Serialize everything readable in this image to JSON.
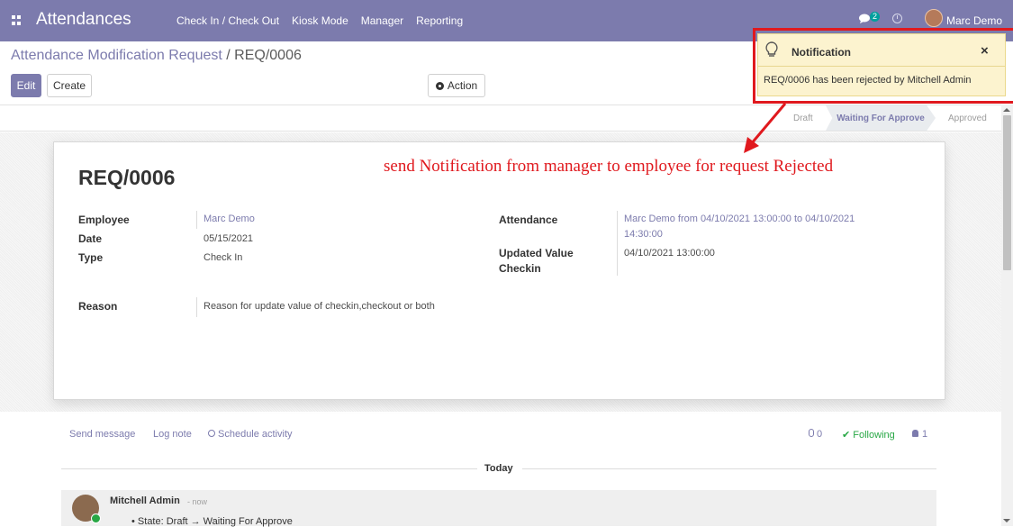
{
  "navbar": {
    "app_name": "Attendances",
    "menu": [
      "Check In / Check Out",
      "Kiosk Mode",
      "Manager",
      "Reporting"
    ],
    "chat_count": "2",
    "user_name": "Marc Demo"
  },
  "control": {
    "breadcrumb_parent": "Attendance Modification Request",
    "breadcrumb_sep": " / ",
    "breadcrumb_current": "REQ/0006",
    "edit_label": "Edit",
    "create_label": "Create",
    "action_label": "Action"
  },
  "statusbar": {
    "stages": [
      "Draft",
      "Waiting For Approve",
      "Approved"
    ],
    "active": "Waiting For Approve"
  },
  "form": {
    "title": "REQ/0006",
    "employee_label": "Employee",
    "employee_value": "Marc Demo",
    "date_label": "Date",
    "date_value": "05/15/2021",
    "type_label": "Type",
    "type_value": "Check In",
    "attendance_label": "Attendance",
    "attendance_value_line1": "Marc Demo from 04/10/2021 13:00:00 to 04/10/2021",
    "attendance_value_line2": "14:30:00",
    "updated_label_line1": "Updated Value",
    "updated_label_line2": "Checkin",
    "updated_value": "04/10/2021 13:00:00",
    "reason_label": "Reason",
    "reason_value": "Reason for update value of checkin,checkout or both"
  },
  "annotation": {
    "text": "send Notification from manager to employee for request Rejected",
    "color": "#e0191e"
  },
  "notification": {
    "title": "Notification",
    "close": "×",
    "message": "REQ/0006 has been rejected by Mitchell Admin"
  },
  "chatter": {
    "send_message": "Send message",
    "log_note": "Log note",
    "schedule_activity": "Schedule activity",
    "attachments": "0",
    "following": "Following",
    "followers": "1",
    "today": "Today",
    "message": {
      "author": "Mitchell Admin",
      "time": "- now",
      "body": "State: Draft → Waiting For Approve"
    }
  },
  "colors": {
    "brand": "#7c7bad",
    "notification_bg": "#fcf3cf",
    "following": "#28a745"
  }
}
